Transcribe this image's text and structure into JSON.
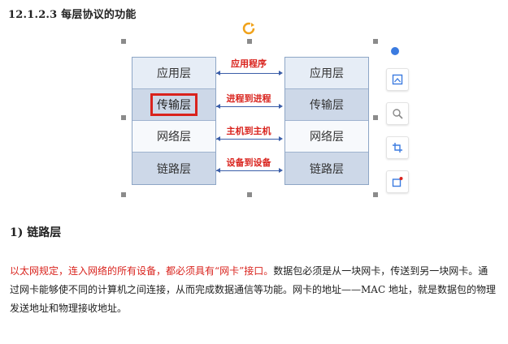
{
  "heading": "12.1.2.3  每层协议的功能",
  "left_layers": [
    "应用层",
    "传输层",
    "网络层",
    "链路层"
  ],
  "right_layers": [
    "应用层",
    "传输层",
    "网络层",
    "链路层"
  ],
  "arrows": [
    "应用程序",
    "进程到进程",
    "主机到主机",
    "设备到设备"
  ],
  "subheading": "1)  链路层",
  "paragraph": {
    "red_part": "以太网规定，连入网络的所有设备，都必须具有“网卡”接口。",
    "rest": "数据包必须是从一块网卡，传送到另一块网卡。通过网卡能够使不同的计算机之间连接，从而完成数据通信等功能。网卡的地址——MAC 地址，就是数据包的物理发送地址和物理接收地址。"
  },
  "colors": {
    "accent_red": "#d9231d",
    "arrow_blue": "#3b5ea8",
    "toolbar_blue": "#3b7be0"
  },
  "toolbar_icons": [
    "layout-icon",
    "zoom-icon",
    "crop-icon",
    "share-icon"
  ]
}
